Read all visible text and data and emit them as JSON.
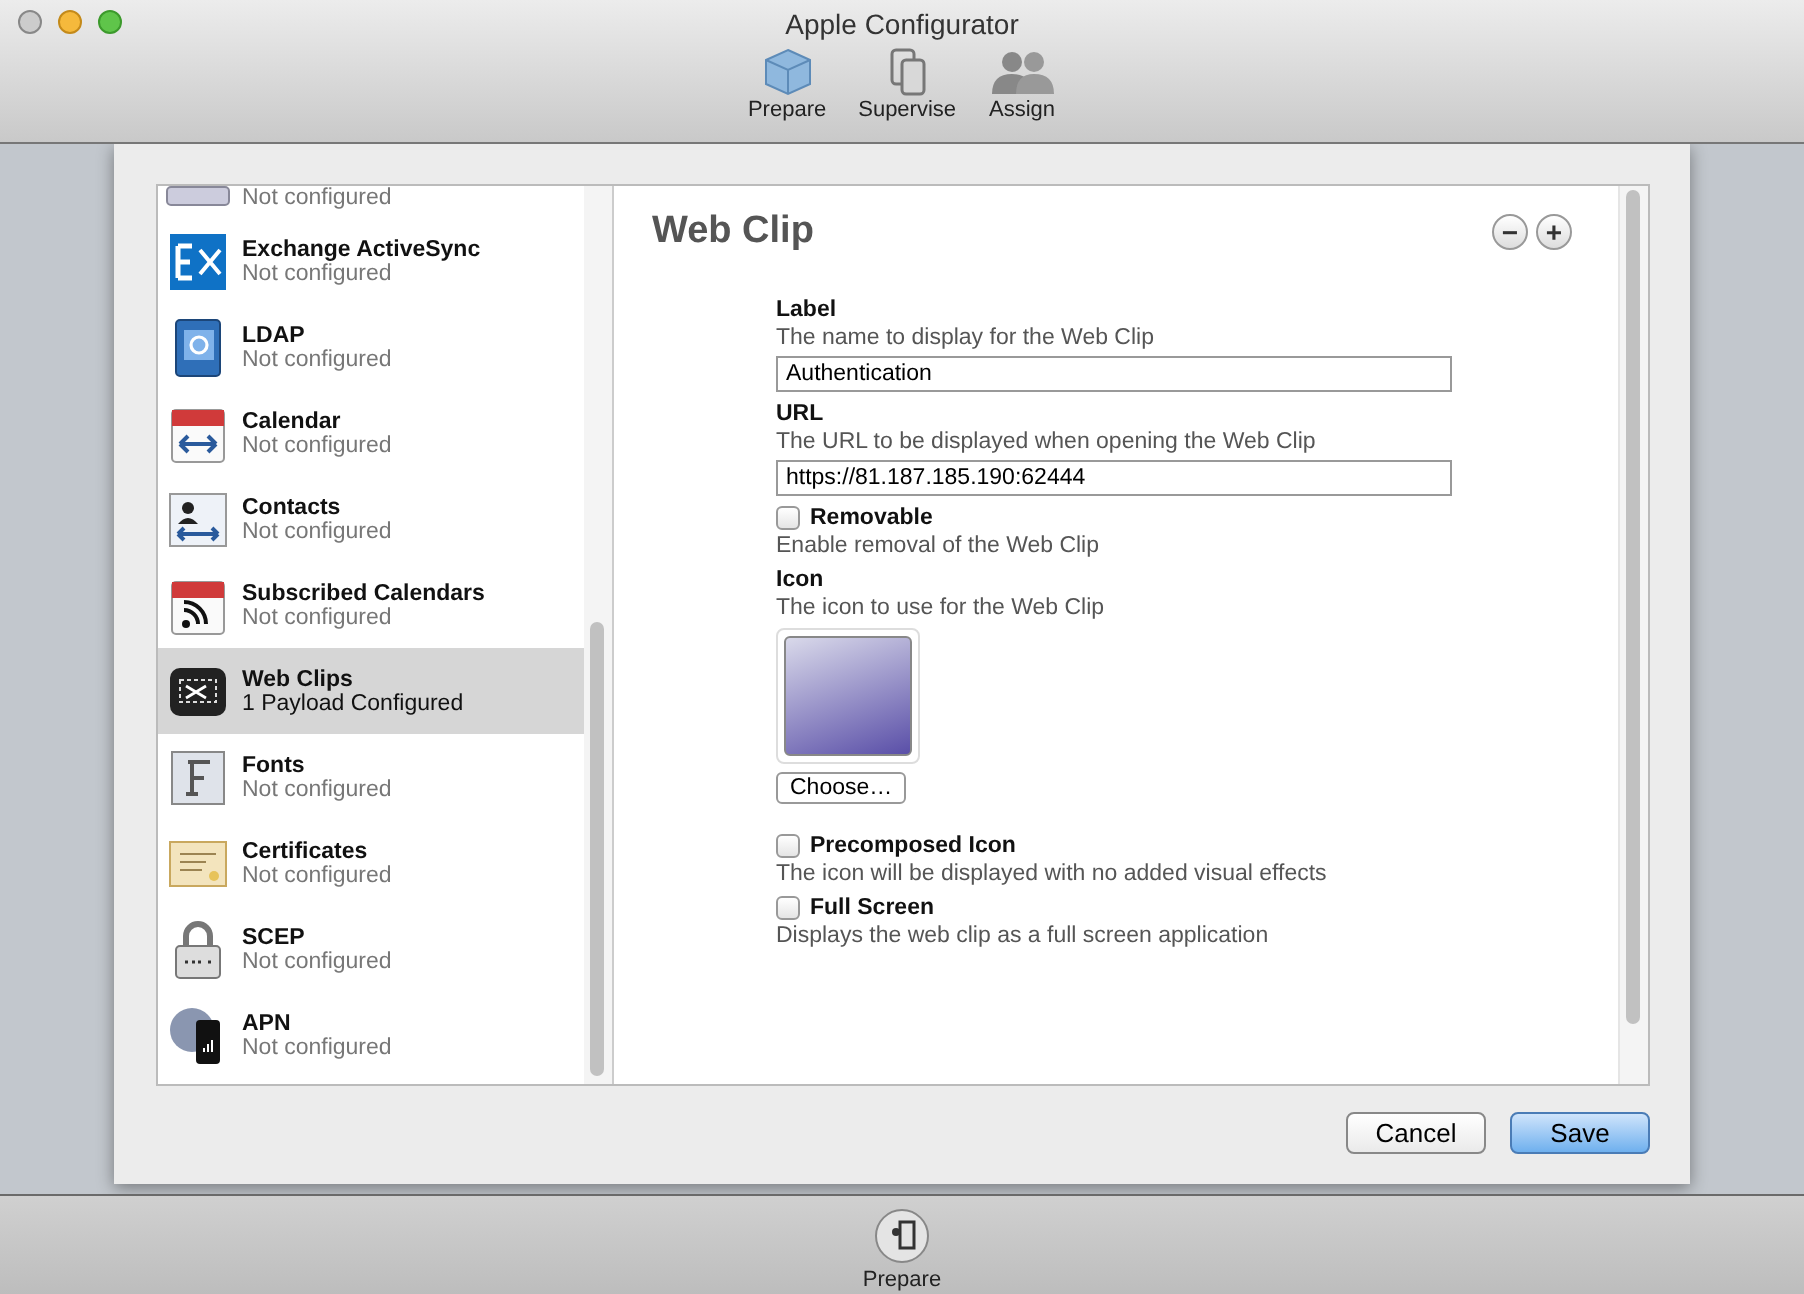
{
  "window": {
    "title": "Apple Configurator"
  },
  "toolbar": [
    {
      "label": "Prepare",
      "kind": "cube",
      "selected": true
    },
    {
      "label": "Supervise",
      "kind": "devices",
      "selected": false
    },
    {
      "label": "Assign",
      "kind": "people",
      "selected": false
    }
  ],
  "sidebar": {
    "items": [
      {
        "kind": "generic",
        "status": "Not configured",
        "selected": false
      },
      {
        "kind": "exchange",
        "title": "Exchange ActiveSync",
        "status": "Not configured",
        "selected": false
      },
      {
        "kind": "ldap",
        "title": "LDAP",
        "status": "Not configured",
        "selected": false
      },
      {
        "kind": "calendar",
        "title": "Calendar",
        "status": "Not configured",
        "selected": false
      },
      {
        "kind": "contacts",
        "title": "Contacts",
        "status": "Not configured",
        "selected": false
      },
      {
        "kind": "subscribed",
        "title": "Subscribed Calendars",
        "status": "Not configured",
        "selected": false
      },
      {
        "kind": "webclip",
        "title": "Web Clips",
        "status": "1 Payload Configured",
        "selected": true
      },
      {
        "kind": "fonts",
        "title": "Fonts",
        "status": "Not configured",
        "selected": false
      },
      {
        "kind": "certificate",
        "title": "Certificates",
        "status": "Not configured",
        "selected": false
      },
      {
        "kind": "scep",
        "title": "SCEP",
        "status": "Not configured",
        "selected": false
      },
      {
        "kind": "apn",
        "title": "APN",
        "status": "Not configured",
        "selected": false
      }
    ]
  },
  "payload": {
    "title": "Web Clip",
    "remove_button": "−",
    "add_button": "+",
    "fields": [
      {
        "kind": "text",
        "label": "Label",
        "description": "The name to display for the Web Clip",
        "value": "Authentication"
      },
      {
        "kind": "text",
        "label": "URL",
        "description": "The URL to be displayed when opening the Web Clip",
        "value": "https://81.187.185.190:62444"
      },
      {
        "kind": "checkbox",
        "label": "Removable",
        "checked": false,
        "description": "Enable removal of the Web Clip"
      },
      {
        "kind": "icon",
        "label": "Icon",
        "description": "The icon to use for the Web Clip",
        "button": "Choose…"
      },
      {
        "kind": "checkbox",
        "label": "Precomposed Icon",
        "checked": false,
        "description": "The icon will be displayed with no added visual effects"
      },
      {
        "kind": "checkbox",
        "label": "Full Screen",
        "checked": false,
        "description": "Displays the web clip as a full screen application"
      }
    ]
  },
  "buttons": [
    {
      "label": "Cancel",
      "default": false
    },
    {
      "label": "Save",
      "default": true
    }
  ],
  "bottom_bar": {
    "label": "Prepare"
  }
}
